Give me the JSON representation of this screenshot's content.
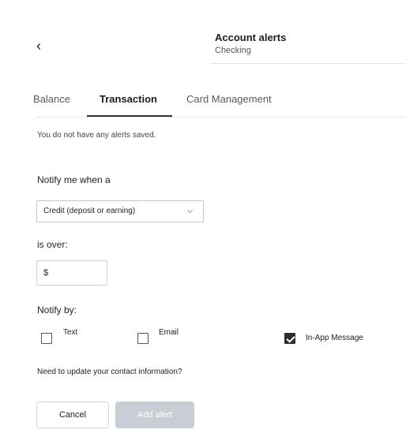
{
  "header": {
    "title": "Account alerts",
    "subtitle": "Checking"
  },
  "tabs": [
    {
      "label": "Balance",
      "active": false
    },
    {
      "label": "Transaction",
      "active": true
    },
    {
      "label": "Card Management",
      "active": false
    }
  ],
  "empty_message": "You do not have any alerts saved.",
  "form": {
    "notify_when_label": "Notify me when a",
    "type_select_value": "Credit (deposit or earning)",
    "is_over_label": "is over:",
    "amount_placeholder": "$",
    "notify_by_label": "Notify by:",
    "channels": [
      {
        "label": "Text",
        "checked": false
      },
      {
        "label": "Email",
        "checked": false
      },
      {
        "label": "In-App Message",
        "checked": true
      }
    ],
    "contact_link": "Need to update your contact information?"
  },
  "actions": {
    "cancel_label": "Cancel",
    "add_label": "Add alert"
  },
  "colors": {
    "add_button_disabled": "#c9ced6",
    "checked_box": "#2b2f34"
  }
}
